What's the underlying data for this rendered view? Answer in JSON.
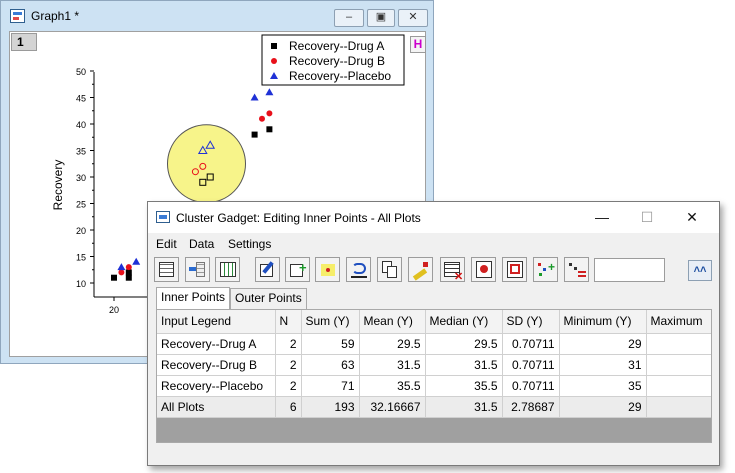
{
  "graph_window": {
    "title": "Graph1 *",
    "layer_number": "1",
    "h_button": "H",
    "controls": {
      "minimize": "–",
      "restore": "▣",
      "close": "✕"
    }
  },
  "chart_data": {
    "type": "scatter",
    "ylabel": "Recovery",
    "xlabel": "",
    "y_ticks": [
      "50",
      "45",
      "40",
      "35",
      "30",
      "25",
      "20",
      "15",
      "10"
    ],
    "x_ticks": [
      "20"
    ],
    "ylim": [
      8,
      50
    ],
    "legend_position": "top-right",
    "series": [
      {
        "name": "Recovery--Drug A",
        "marker": "square",
        "color": "#000000",
        "points": [
          [
            20,
            11
          ],
          [
            22,
            11
          ],
          [
            22,
            12
          ],
          [
            39,
            38
          ],
          [
            41,
            39
          ]
        ],
        "selected_points": [
          [
            32,
            29
          ],
          [
            33,
            30
          ]
        ]
      },
      {
        "name": "Recovery--Drug B",
        "marker": "circle",
        "color": "#e8101a",
        "points": [
          [
            21,
            12
          ],
          [
            22,
            13
          ],
          [
            40,
            41
          ],
          [
            41,
            42
          ]
        ],
        "selected_points": [
          [
            31,
            31
          ],
          [
            32,
            32
          ]
        ]
      },
      {
        "name": "Recovery--Placebo",
        "marker": "triangle",
        "color": "#1f31d6",
        "points": [
          [
            21,
            13
          ],
          [
            23,
            14
          ],
          [
            39,
            45
          ],
          [
            41,
            46
          ]
        ],
        "selected_points": [
          [
            32,
            35
          ],
          [
            33,
            36
          ]
        ]
      }
    ],
    "cluster_circle": {
      "center": [
        32.5,
        32.5
      ],
      "fill": "#f7f48a"
    }
  },
  "dialog": {
    "title": "Cluster Gadget: Editing Inner Points - All Plots",
    "controls": {
      "minimize": "—",
      "maximize": "☐",
      "close": "✕"
    },
    "menu": [
      "Edit",
      "Data",
      "Settings"
    ],
    "toolbar_icons": [
      "worksheet-icon",
      "add-column-icon",
      "data-table-icon",
      "edit-icon",
      "add-plot-icon",
      "mark-points-icon",
      "undo-icon",
      "copy-icon",
      "mask-edit-icon",
      "table-delete-icon",
      "mask-points-icon",
      "unmask-icon",
      "scatter-add-icon",
      "scatter-remove-icon"
    ],
    "toolbar_field_value": "",
    "collapse_button": "˄˄",
    "tabs": [
      {
        "label": "Inner Points",
        "active": true
      },
      {
        "label": "Outer Points",
        "active": false
      }
    ],
    "table": {
      "columns": [
        "Input Legend",
        "N",
        "Sum (Y)",
        "Mean (Y)",
        "Median (Y)",
        "SD (Y)",
        "Minimum (Y)",
        "Maximum"
      ],
      "rows": [
        [
          "Recovery--Drug A",
          "2",
          "59",
          "29.5",
          "29.5",
          "0.70711",
          "29",
          ""
        ],
        [
          "Recovery--Drug B",
          "2",
          "63",
          "31.5",
          "31.5",
          "0.70711",
          "31",
          ""
        ],
        [
          "Recovery--Placebo",
          "2",
          "71",
          "35.5",
          "35.5",
          "0.70711",
          "35",
          ""
        ],
        [
          "All Plots",
          "6",
          "193",
          "32.16667",
          "31.5",
          "2.78687",
          "29",
          ""
        ]
      ]
    }
  }
}
